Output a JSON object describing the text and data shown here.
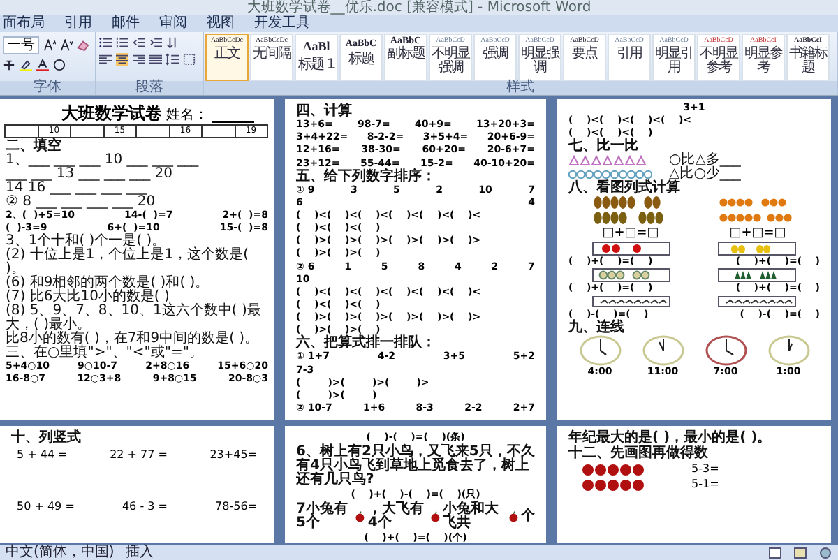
{
  "window": {
    "title": "大班数学试卷__优乐.doc [兼容模式] - Microsoft Word"
  },
  "tabs": [
    "面布局",
    "引用",
    "邮件",
    "审阅",
    "视图",
    "开发工具"
  ],
  "ribbon": {
    "font_size": "一号",
    "groups": [
      "字体",
      "段落",
      "样式"
    ],
    "styles": [
      {
        "preview": "AaBbCcDc",
        "name": "正文",
        "selected": true
      },
      {
        "preview": "AaBbCcDc",
        "name": "无间隔",
        "selected": false
      },
      {
        "preview": "AaBl",
        "name": "标题 1",
        "selected": false
      },
      {
        "preview": "AaBbC",
        "name": "标题",
        "selected": false
      },
      {
        "preview": "AaBbC",
        "name": "副标题",
        "selected": false
      },
      {
        "preview": "AaBbCcD",
        "name": "不明显强调",
        "selected": false
      },
      {
        "preview": "AaBbCcD",
        "name": "强调",
        "selected": false
      },
      {
        "preview": "AaBbCcD",
        "name": "明显强调",
        "selected": false
      },
      {
        "preview": "AaBbCcD",
        "name": "要点",
        "selected": false
      },
      {
        "preview": "AaBbCcD",
        "name": "引用",
        "selected": false
      },
      {
        "preview": "AaBbCcD",
        "name": "明显引用",
        "selected": false
      },
      {
        "preview": "AaBbCcD",
        "name": "不明显参考",
        "selected": false
      },
      {
        "preview": "AaBbCcI",
        "name": "明显参考",
        "selected": false
      },
      {
        "preview": "AaBbCcI",
        "name": "书籍标题",
        "selected": false
      }
    ]
  },
  "page_1": {
    "title": "大班数学试卷",
    "name_label": "姓名：",
    "score_table": [
      "10",
      "15",
      "16",
      "19"
    ],
    "lines": [
      {
        "kind": "heading",
        "text": "二、填空"
      },
      {
        "kind": "text",
        "text": "1、___ ___ ___ 10 ___ ___ ___"
      },
      {
        "kind": "text",
        "text": "___ ___ 13 ___ ___ ___ 20"
      },
      {
        "kind": "text",
        "text": "14  16  ___  ___  ___  ___"
      },
      {
        "kind": "text",
        "text": "② 8  ___  ___  ___  ___  20"
      },
      {
        "kind": "row",
        "cells": [
          "2、(  )+5=10",
          "14-(  )=7",
          "2+(  )=8"
        ]
      },
      {
        "kind": "row",
        "cells": [
          "(  )-3=9",
          "6+(  )=10",
          "15-(  )=8"
        ]
      },
      {
        "kind": "text",
        "text": "3、1个十和(  )个一是(  )。"
      },
      {
        "kind": "text",
        "text": "(2) 十位上是1，个位上是1，这个数是(  )。"
      },
      {
        "kind": "text",
        "text": "(6) 和9相邻的两个数是(  )和(  )。"
      },
      {
        "kind": "text",
        "text": "(7) 比6大比10小的数是(  )"
      },
      {
        "kind": "text",
        "text": "(8) 5、9、7、8、10、1这六个数中(  )最大，(  )最小。"
      },
      {
        "kind": "text",
        "text": "比8小的数有(  )，在7和9中间的数是(  )。"
      },
      {
        "kind": "text",
        "text": "三、在○里填\">\"、\"<\"或\"=\"。"
      },
      {
        "kind": "row",
        "cells": [
          "5+4○10",
          "9○10-7",
          "2+8○16",
          "15+6○20"
        ]
      },
      {
        "kind": "row",
        "cells": [
          "16-8○7",
          "12○3+8",
          "9+8○15",
          "20-8○3"
        ]
      }
    ]
  },
  "page_2": {
    "lines": [
      {
        "kind": "heading",
        "text": "四、计算"
      },
      {
        "kind": "row",
        "cells": [
          "13+6=",
          "98-7=",
          "40+9=",
          "13+20+3="
        ]
      },
      {
        "kind": "row",
        "cells": [
          "3+4+22=",
          "8-2-2=",
          "3+5+4=",
          "20+6-9="
        ]
      },
      {
        "kind": "row",
        "cells": [
          "12+16=",
          "38-30=",
          "60+20=",
          "20-6+7="
        ]
      },
      {
        "kind": "row",
        "cells": [
          "23+12=",
          "55-44=",
          "15-2=",
          "40-10+20="
        ]
      },
      {
        "kind": "heading",
        "text": "五、给下列数字排序："
      },
      {
        "kind": "row",
        "cells": [
          "① 9",
          "3",
          "5",
          "2",
          "10",
          "7"
        ]
      },
      {
        "kind": "row",
        "cells": [
          "6",
          "4"
        ]
      },
      {
        "kind": "row",
        "cells": [
          "(    )<(    )<(    )<(    )<(    )<(    )<"
        ]
      },
      {
        "kind": "row",
        "cells": [
          "(    )<(    )<(    )"
        ]
      },
      {
        "kind": "row",
        "cells": [
          "(    )>(    )>(    )>(    )>(    )>(    )>"
        ]
      },
      {
        "kind": "row",
        "cells": [
          "(    )>(    )>(    )"
        ]
      },
      {
        "kind": "row",
        "cells": [
          "② 6",
          "1",
          "5",
          "8",
          "4",
          "2",
          "7"
        ]
      },
      {
        "kind": "row",
        "cells": [
          "10"
        ]
      },
      {
        "kind": "row",
        "cells": [
          "(    )<(    )<(    )<(    )<(    )<(    )<"
        ]
      },
      {
        "kind": "row",
        "cells": [
          "(    )<(    )<(    )"
        ]
      },
      {
        "kind": "row",
        "cells": [
          "(    )>(    )>(    )>(    )>(    )>(    )>"
        ]
      },
      {
        "kind": "row",
        "cells": [
          "(    )>(    )>(    )"
        ]
      },
      {
        "kind": "heading",
        "text": "六、把算式排一排队："
      },
      {
        "kind": "row",
        "cells": [
          "① 1+7",
          "4-2",
          "3+5",
          "5+2"
        ]
      },
      {
        "kind": "row",
        "cells": [
          "7-3"
        ]
      },
      {
        "kind": "row",
        "cells": [
          "(        )>(        )>(        )>"
        ]
      },
      {
        "kind": "row",
        "cells": [
          "(        )>(        )"
        ]
      },
      {
        "kind": "row",
        "cells": [
          "② 10-7",
          "1+6",
          "8-3",
          "2-2",
          "2+7"
        ]
      }
    ]
  },
  "page_3": {
    "top_expr": "3+1",
    "top_blanks": [
      "(    )<(    )<(    )<(    )<",
      "(    )<(    )<(    )"
    ],
    "section_7": {
      "heading": "七、比一比",
      "compare": [
        "○比△多___",
        "△比○少___"
      ]
    },
    "section_8": {
      "heading": "八、看图列式计算",
      "equations": [
        "□+□=□",
        "□+□=□"
      ],
      "blanks": [
        "(    )+(    )=(    )",
        "(    )+(    )=(    )",
        "(    )+(    )=(    )",
        "(    )+(    )=(    )",
        "(    )-(    )=(    )",
        "(    )-(    )=(    )"
      ]
    },
    "section_9": {
      "heading": "九、连线",
      "times": [
        "4:00",
        "11:00",
        "7:00",
        "1:00"
      ]
    }
  },
  "page_4": {
    "heading": "十、列竖式",
    "rows": [
      [
        "5 + 44 =",
        "22 + 77 =",
        "23+45="
      ],
      [
        "50 + 49 =",
        "46 - 3 =",
        "78-56="
      ]
    ]
  },
  "page_5": {
    "blank_1": "(    )-(    )=(    )(条)",
    "question_6": "6、树上有2只小鸟，又飞来5只，不久有4只小鸟飞到草地上觅食去了，树上还有几只鸟?",
    "blank_2": "(    )+(    )-(    )=(    )(只)",
    "question_7": [
      "7小兔有5个",
      "，大飞有4个",
      "小兔和大飞共",
      "个"
    ],
    "blank_3": "(    )+(    )=(    )(个)"
  },
  "page_6": {
    "text": "年纪最大的是(        )，最小的是(        )。",
    "heading": "十二、先画图再做得数",
    "exprs": [
      "5-3=",
      "5-1="
    ]
  },
  "status_bar": {
    "language": "中文(简体，中国)",
    "mode": "插入"
  }
}
